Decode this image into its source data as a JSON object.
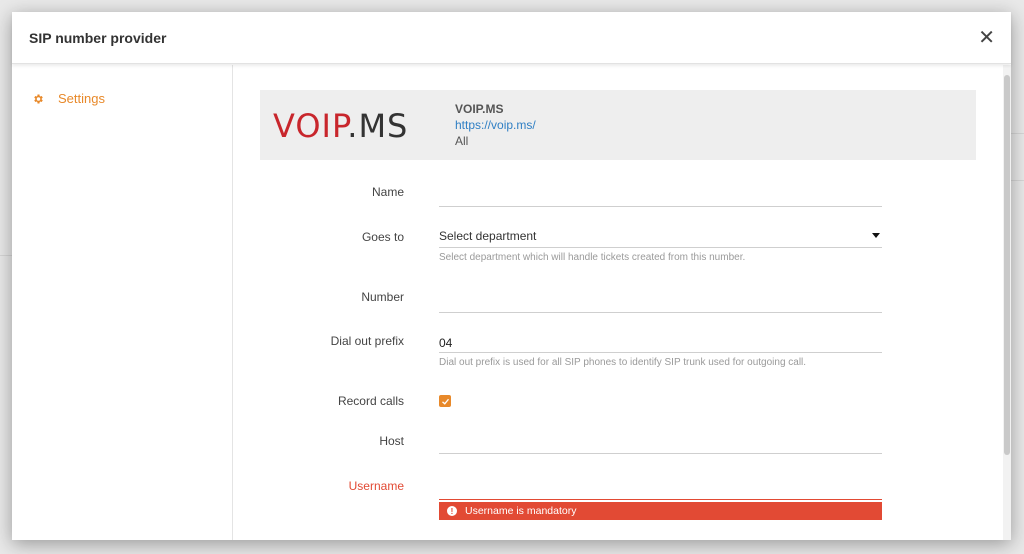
{
  "modal": {
    "title": "SIP number provider",
    "close_glyph": "✕"
  },
  "sidebar": {
    "items": [
      {
        "label": "Settings",
        "icon": "gear-icon",
        "active": true
      }
    ]
  },
  "provider": {
    "logo_text": "VOIP.MS",
    "name": "VOIP.MS",
    "url": "https://voip.ms/",
    "scope": "All"
  },
  "form": {
    "name": {
      "label": "Name",
      "value": ""
    },
    "goes_to": {
      "label": "Goes to",
      "value": "Select department",
      "hint": "Select department which will handle tickets created from this number."
    },
    "number": {
      "label": "Number",
      "value": ""
    },
    "dial_out_prefix": {
      "label": "Dial out prefix",
      "value": "04",
      "hint": "Dial out prefix is used for all SIP phones to identify SIP trunk used for outgoing call."
    },
    "record_calls": {
      "label": "Record calls",
      "checked": true
    },
    "host": {
      "label": "Host",
      "value": ""
    },
    "username": {
      "label": "Username",
      "value": "",
      "error": "Username is mandatory"
    }
  },
  "colors": {
    "accent": "#e8892a",
    "error": "#e24a34",
    "link": "#2f7fc4",
    "logo_red": "#c8262c",
    "logo_dark": "#333333"
  }
}
